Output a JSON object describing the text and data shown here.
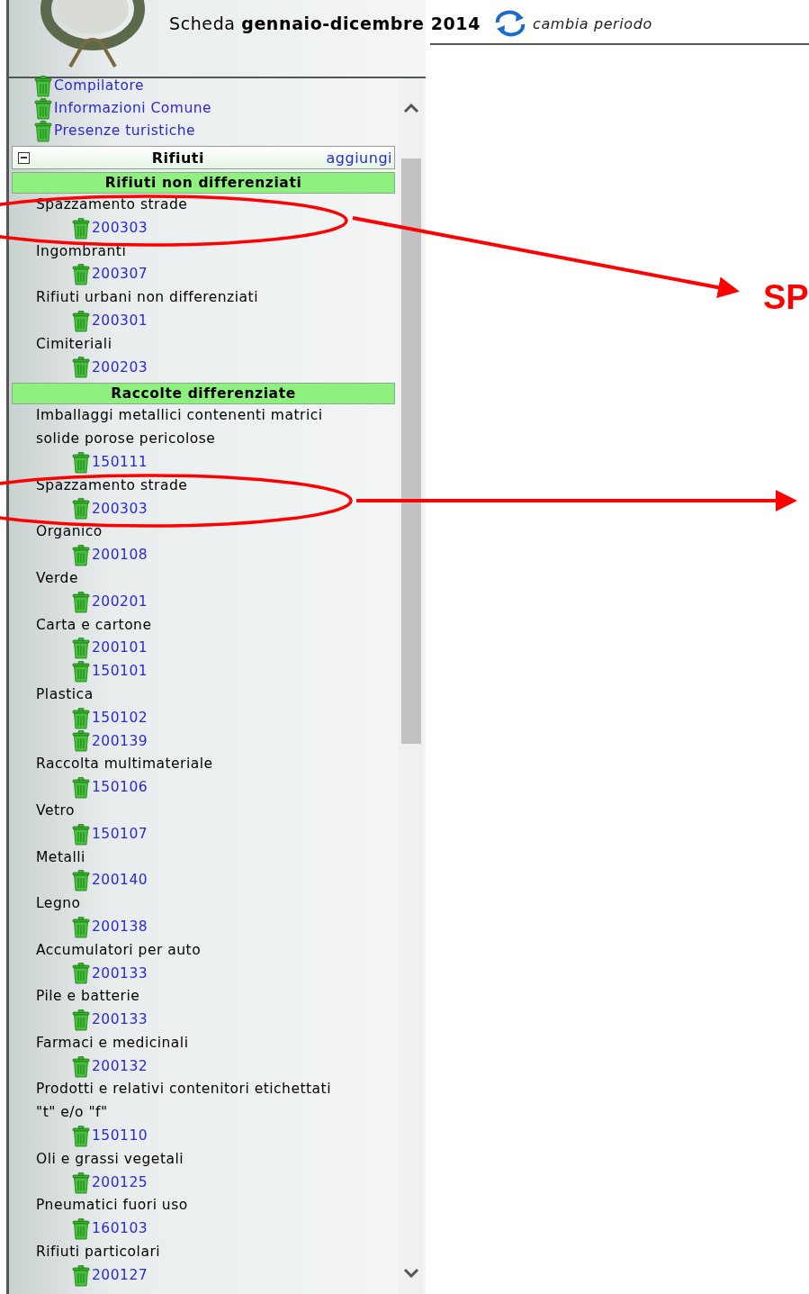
{
  "header": {
    "title_prefix": "Scheda",
    "period": "gennaio-dicembre 2014",
    "change_link": "cambia periodo"
  },
  "nav_links": [
    "Compilatore",
    "Informazioni Comune",
    "Presenze turistiche"
  ],
  "section": {
    "title": "Rifiuti",
    "expanded": true,
    "add_link": "aggiungi",
    "groups": [
      {
        "title": "Rifiuti non differenziati",
        "items": [
          {
            "name": "Spazzamento strade",
            "codes": [
              "200303"
            ]
          },
          {
            "name": "Ingombranti",
            "codes": [
              "200307"
            ]
          },
          {
            "name": "Rifiuti urbani non differenziati",
            "codes": [
              "200301"
            ]
          },
          {
            "name": "Cimiteriali",
            "codes": [
              "200203"
            ]
          }
        ]
      },
      {
        "title": "Raccolte differenziate",
        "items": [
          {
            "name": "Imballaggi metallici contenenti matrici solide porose pericolose",
            "codes": [
              "150111"
            ]
          },
          {
            "name": "Spazzamento strade",
            "codes": [
              "200303"
            ]
          },
          {
            "name": "Organico",
            "codes": [
              "200108"
            ]
          },
          {
            "name": "Verde",
            "codes": [
              "200201"
            ]
          },
          {
            "name": "Carta e cartone",
            "codes": [
              "200101",
              "150101"
            ]
          },
          {
            "name": "Plastica",
            "codes": [
              "150102",
              "200139"
            ]
          },
          {
            "name": "Raccolta multimateriale",
            "codes": [
              "150106"
            ]
          },
          {
            "name": "Vetro",
            "codes": [
              "150107"
            ]
          },
          {
            "name": "Metalli",
            "codes": [
              "200140"
            ]
          },
          {
            "name": "Legno",
            "codes": [
              "200138"
            ]
          },
          {
            "name": "Accumulatori per auto",
            "codes": [
              "200133"
            ]
          },
          {
            "name": "Pile e batterie",
            "codes": [
              "200133"
            ]
          },
          {
            "name": "Farmaci e medicinali",
            "codes": [
              "200132"
            ]
          },
          {
            "name": "Prodotti e relativi contenitori etichettati \"t\" e/o \"f\"",
            "codes": [
              "150110"
            ]
          },
          {
            "name": "Oli e grassi vegetali",
            "codes": [
              "200125"
            ]
          },
          {
            "name": "Pneumatici fuori uso",
            "codes": [
              "160103"
            ]
          },
          {
            "name": "Rifiuti particolari",
            "codes": [
              "200127"
            ]
          }
        ]
      }
    ]
  },
  "annotation": {
    "label": "SP"
  }
}
